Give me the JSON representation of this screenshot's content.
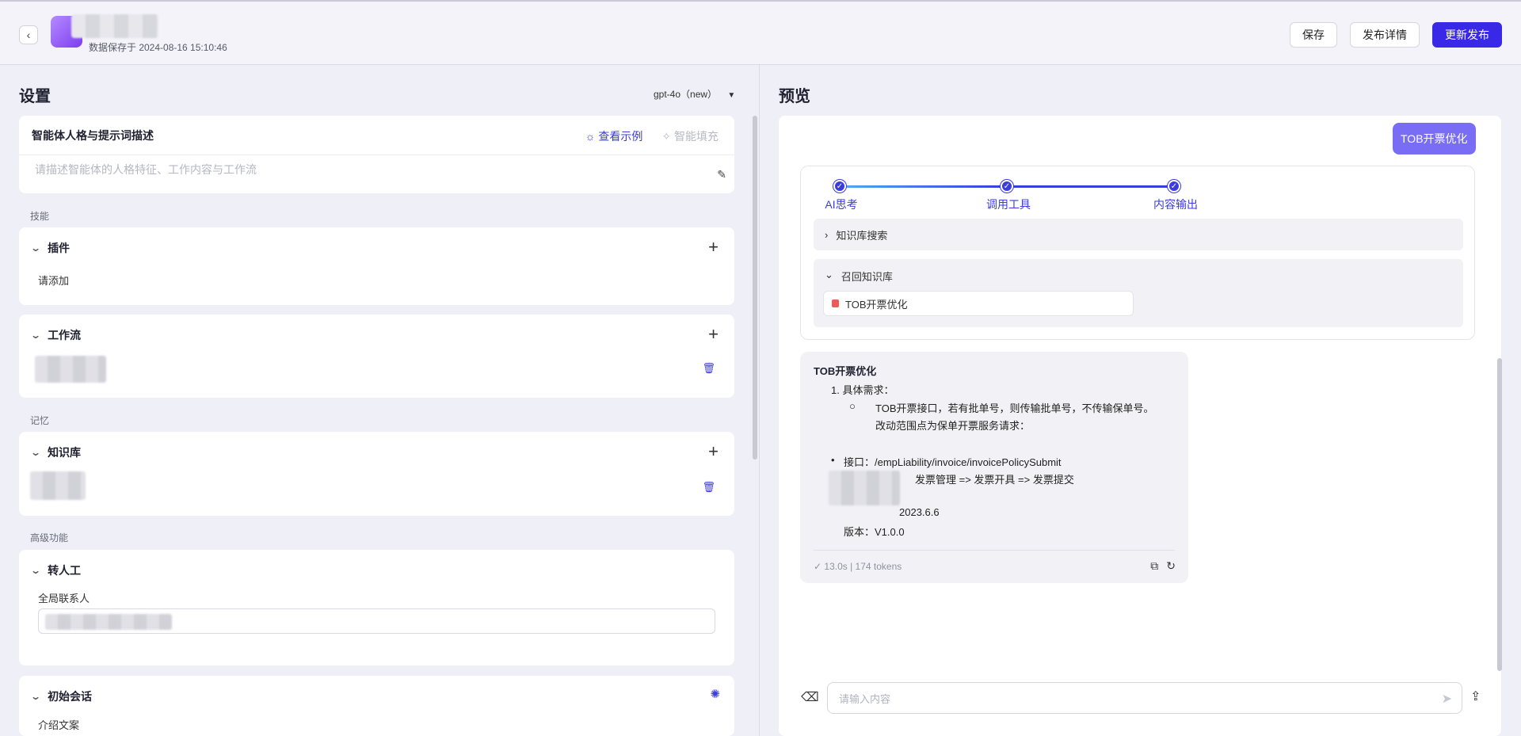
{
  "header": {
    "back_icon": "chevron-left-icon",
    "save_time": "数据保存于 2024-08-16 15:10:46",
    "save_label": "保存",
    "detail_label": "发布详情",
    "publish_label": "更新发布"
  },
  "left": {
    "title": "设置",
    "model": "gpt-4o（new）",
    "prompt": {
      "title": "智能体人格与提示词描述",
      "example_label": "查看示例",
      "autofill_label": "智能填充",
      "placeholder": "请描述智能体的人格特征、工作内容与工作流"
    },
    "skills_label": "技能",
    "plugin": {
      "title": "插件",
      "empty": "请添加"
    },
    "workflow": {
      "title": "工作流"
    },
    "memory_label": "记忆",
    "knowledge": {
      "title": "知识库"
    },
    "advanced_label": "高级功能",
    "transfer": {
      "title": "转人工",
      "contact_label": "全局联系人"
    },
    "opening": {
      "title": "初始会话",
      "intro_label": "介绍文案"
    }
  },
  "right": {
    "title": "预览",
    "user_message": "TOB开票优化",
    "steps": [
      "AI思考",
      "调用工具",
      "内容输出"
    ],
    "kb_search_label": "知识库搜索",
    "kb_recall_label": "召回知识库",
    "kb_chip": "TOB开票优化",
    "answer": {
      "title": "TOB开票优化",
      "item1": "1. 具体需求：",
      "sub1": "TOB开票接口，若有批单号，则传输批单号，不传输保单号。",
      "sub2": "改动范围点为保单开票服务请求：",
      "api": "接口：/empLiability/invoice/invoicePolicySubmit",
      "path": "发票管理 => 发票开具 => 发票提交",
      "date": "2023.6.6",
      "version": "版本：V1.0.0",
      "meta": "13.0s | 174 tokens"
    },
    "input_placeholder": "请输入内容"
  },
  "colors": {
    "accent": "#3a28e8",
    "user_bubble": "#7a6df5"
  }
}
